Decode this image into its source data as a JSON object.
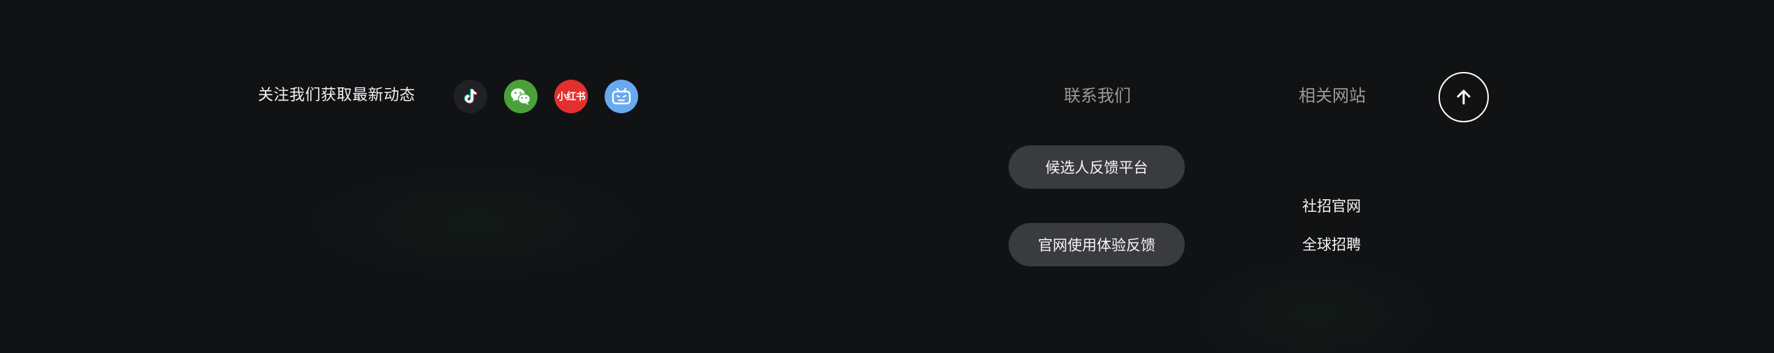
{
  "follow": {
    "label": "关注我们获取最新动态",
    "icons": [
      {
        "name": "douyin-icon",
        "color": "#202124"
      },
      {
        "name": "wechat-icon",
        "color": "#4aa13a"
      },
      {
        "name": "xiaohongshu-icon",
        "color": "#e3302f",
        "text": "小红书"
      },
      {
        "name": "bilibili-icon",
        "color": "#68a9ef"
      }
    ]
  },
  "contact": {
    "title": "联系我们",
    "buttons": [
      "候选人反馈平台",
      "官网使用体验反馈"
    ]
  },
  "related": {
    "title": "相关网站",
    "links": [
      "社招官网",
      "全球招聘"
    ]
  },
  "back_to_top": {
    "icon": "arrow-up-icon"
  },
  "colors": {
    "background": "#111214",
    "pill": "#3a3b3f",
    "muted_title": "#9a9a9a"
  }
}
